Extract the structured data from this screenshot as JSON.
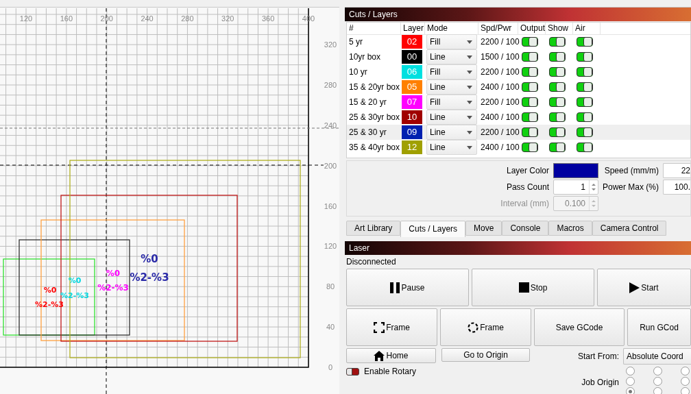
{
  "canvas": {
    "x_ruler": [
      "120",
      "160",
      "200",
      "240",
      "280",
      "320",
      "360",
      "400"
    ],
    "y_ruler": [
      "320",
      "280",
      "240",
      "200",
      "160",
      "120",
      "80",
      "40",
      "0"
    ],
    "labels": [
      {
        "lines": [
          "%0",
          "%2-%3"
        ],
        "color": "#ff0000"
      },
      {
        "lines": [
          "%0",
          "%2-%3"
        ],
        "color": "#00d8e0"
      },
      {
        "lines": [
          "%0",
          "%2-%3"
        ],
        "color": "#ff00ff"
      },
      {
        "lines": [
          "%0",
          "%2-%3"
        ],
        "color": "#2a2aa8"
      }
    ]
  },
  "cuts_panel": {
    "title": "Cuts / Layers",
    "columns": [
      "#",
      "Layer",
      "Mode",
      "Spd/Pwr",
      "Output",
      "Show",
      "Air"
    ],
    "rows": [
      {
        "name": "5 yr",
        "layer": "02",
        "color": "#ff0000",
        "mode": "Fill",
        "spd_pwr": "2200 / 100",
        "output": true,
        "show": true,
        "air": true,
        "selected": false
      },
      {
        "name": "10yr box",
        "layer": "00",
        "color": "#000000",
        "mode": "Line",
        "spd_pwr": "1500 / 100",
        "output": true,
        "show": true,
        "air": true,
        "selected": false
      },
      {
        "name": "10 yr",
        "layer": "06",
        "color": "#00e0e0",
        "mode": "Fill",
        "spd_pwr": "2200 / 100",
        "output": true,
        "show": true,
        "air": true,
        "selected": false
      },
      {
        "name": "15 & 20yr box",
        "layer": "05",
        "color": "#ff8000",
        "mode": "Line",
        "spd_pwr": "2400 / 100",
        "output": true,
        "show": true,
        "air": true,
        "selected": false
      },
      {
        "name": "15 & 20 yr",
        "layer": "07",
        "color": "#ff00ff",
        "mode": "Fill",
        "spd_pwr": "2200 / 100",
        "output": true,
        "show": true,
        "air": true,
        "selected": false
      },
      {
        "name": "25 & 30yr box",
        "layer": "10",
        "color": "#a00000",
        "mode": "Line",
        "spd_pwr": "2400 / 100",
        "output": true,
        "show": true,
        "air": true,
        "selected": false
      },
      {
        "name": "25 & 30 yr",
        "layer": "09",
        "color": "#0020b0",
        "mode": "Line",
        "spd_pwr": "2200 / 100",
        "output": true,
        "show": true,
        "air": true,
        "selected": true
      },
      {
        "name": "35 & 40yr box",
        "layer": "12",
        "color": "#a0a000",
        "mode": "Line",
        "spd_pwr": "2400 / 100",
        "output": true,
        "show": true,
        "air": true,
        "selected": false
      }
    ],
    "layer_color": {
      "label": "Layer Color",
      "color": "#0000a0"
    },
    "pass_count": {
      "label": "Pass Count",
      "value": "1"
    },
    "interval": {
      "label": "Interval (mm)",
      "value": "0.100",
      "disabled": true
    },
    "speed": {
      "label": "Speed (mm/m)",
      "value": "22"
    },
    "power_max": {
      "label": "Power Max (%)",
      "value": "100."
    }
  },
  "tabs": [
    {
      "label": "Art Library",
      "selected": false
    },
    {
      "label": "Cuts / Layers",
      "selected": true
    },
    {
      "label": "Move",
      "selected": false
    },
    {
      "label": "Console",
      "selected": false
    },
    {
      "label": "Macros",
      "selected": false
    },
    {
      "label": "Camera Control",
      "selected": false
    }
  ],
  "laser_panel": {
    "title": "Laser",
    "status": "Disconnected",
    "main_buttons": [
      {
        "label": "Pause",
        "kind": "pause"
      },
      {
        "label": "Stop",
        "kind": "stop"
      },
      {
        "label": "Start",
        "kind": "start"
      }
    ],
    "frame_buttons": [
      {
        "label": "Frame",
        "kind": "rect-frame"
      },
      {
        "label": "Frame",
        "kind": "circle-frame"
      },
      {
        "label": "Save GCode",
        "kind": "plain"
      },
      {
        "label": "Run GCod",
        "kind": "plain"
      }
    ],
    "home_button": "Home",
    "origin_button": "Go to Origin",
    "start_from": {
      "label": "Start From:",
      "value": "Absolute Coord"
    },
    "enable_rotary": {
      "label": "Enable Rotary",
      "on": false
    },
    "job_origin": {
      "label": "Job Origin",
      "options": [
        {
          "selected": false
        },
        {
          "selected": false
        },
        {
          "selected": false
        },
        {
          "selected": false
        },
        {
          "selected": false
        },
        {
          "selected": false
        },
        {
          "selected": true
        },
        {
          "selected": false
        },
        {
          "selected": false
        }
      ]
    }
  }
}
